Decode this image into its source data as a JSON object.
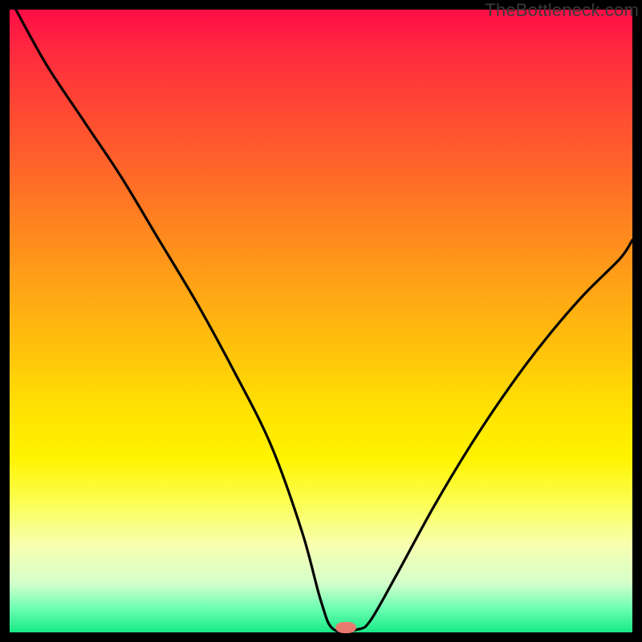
{
  "watermark": "TheBottleneck.com",
  "marker": {
    "x_frac": 0.54,
    "y_frac": 0.992,
    "w": 26,
    "h": 14,
    "color": "#e87b70"
  },
  "chart_data": {
    "type": "line",
    "title": "",
    "xlabel": "",
    "ylabel": "",
    "xlim": [
      0,
      1
    ],
    "ylim": [
      0,
      1
    ],
    "series": [
      {
        "name": "bottleneck-curve",
        "x": [
          0.01,
          0.06,
          0.12,
          0.18,
          0.24,
          0.3,
          0.36,
          0.42,
          0.47,
          0.5,
          0.52,
          0.56,
          0.58,
          0.62,
          0.68,
          0.74,
          0.8,
          0.86,
          0.92,
          0.98,
          1.0
        ],
        "y": [
          1.0,
          0.91,
          0.82,
          0.73,
          0.63,
          0.53,
          0.42,
          0.3,
          0.16,
          0.05,
          0.005,
          0.005,
          0.02,
          0.09,
          0.2,
          0.3,
          0.39,
          0.47,
          0.54,
          0.6,
          0.63
        ]
      }
    ],
    "annotations": [
      {
        "text": "TheBottleneck.com",
        "position": "top-right"
      }
    ]
  }
}
